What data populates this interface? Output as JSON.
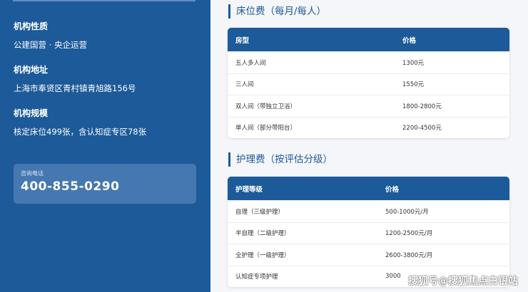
{
  "sidebar": {
    "nature": {
      "label": "机构性质",
      "value": "公建国营 · 央企运营"
    },
    "address": {
      "label": "机构地址",
      "value": "上海市奉贤区青村镇青旭路156号"
    },
    "scale": {
      "label": "机构规模",
      "value": "核定床位499张，含认知症专区78张"
    },
    "phone": {
      "label": "咨询电话",
      "number": "400-855-0290"
    }
  },
  "bed_section": {
    "title": "床位费（每月/每人）",
    "headers": [
      "房型",
      "价格"
    ],
    "rows": [
      [
        "五人多人间",
        "1300元"
      ],
      [
        "三人间",
        "1550元"
      ],
      [
        "双人间（带独立卫浴）",
        "1800-2800元"
      ],
      [
        "单人间（部分带阳台）",
        "2200-4500元"
      ]
    ]
  },
  "care_section": {
    "title": "护理费（按评估分级）",
    "headers": [
      "护理等级",
      "价格"
    ],
    "rows": [
      [
        "自理（三级护理）",
        "500-1000元/月"
      ],
      [
        "半自理（二级护理）",
        "1200-2500元/月"
      ],
      [
        "全护理（一级护理）",
        "2600-3800元/月"
      ],
      [
        "认知症专项护理",
        "3000"
      ]
    ]
  },
  "watermark": "搜狐号@搜狐焦点白银站",
  "colors": {
    "primary": "#1c5a99",
    "card": "#4578b0",
    "background": "#f4f6f9"
  }
}
